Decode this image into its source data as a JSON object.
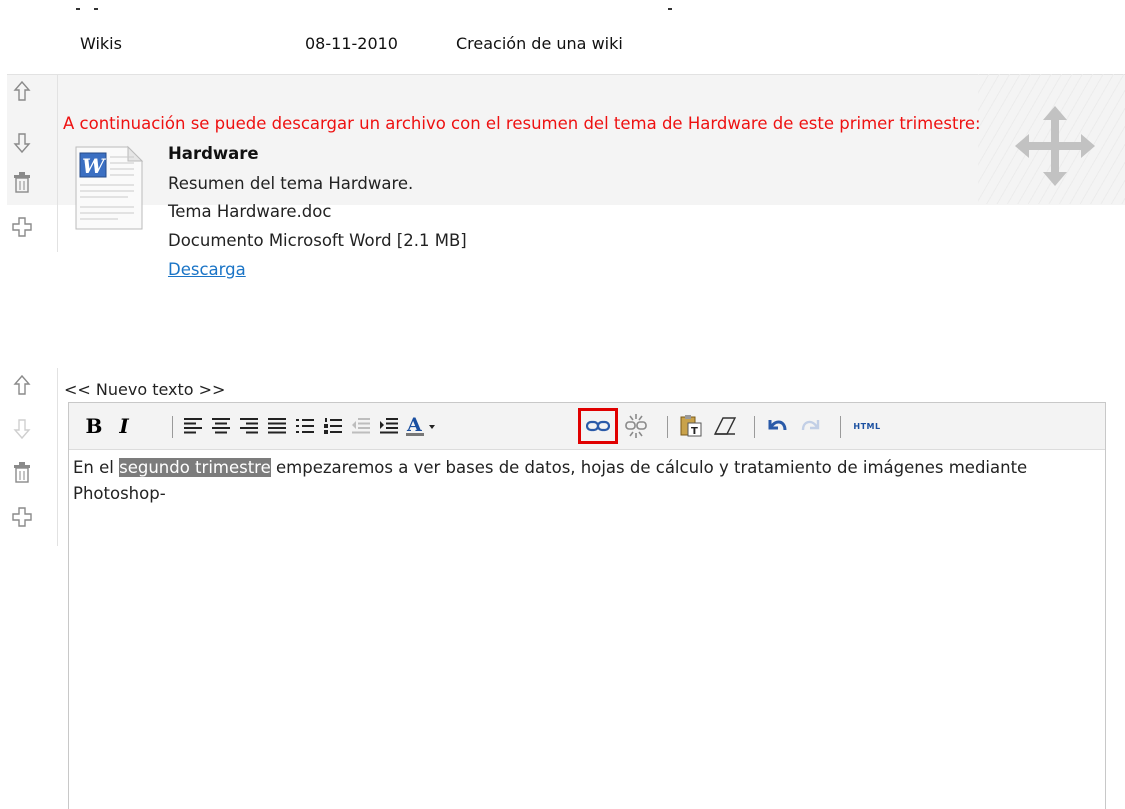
{
  "top_row": {
    "section": "Wikis",
    "date": "08-11-2010",
    "description": "Creación de una wiki"
  },
  "block1": {
    "message": "A continuación se puede descargar un archivo con el resumen del tema de Hardware de este primer trimestre:",
    "file": {
      "title": "Hardware",
      "description": "Resumen del tema Hardware.",
      "filename": "Tema Hardware.doc",
      "type": "Documento Microsoft Word [2.1 MB]",
      "link": "Descarga"
    }
  },
  "block2": {
    "label": "<< Nuevo texto >>",
    "toolbar": {
      "bold": "B",
      "italic": "I",
      "html": "HTML"
    },
    "content_before": "En el ",
    "content_highlight": "segundo trimestre",
    "content_after": " empezaremos a ver bases de datos, hojas de cálculo y tratamiento de imágenes mediante Photoshop-"
  },
  "colors": {
    "message_red": "#ee1111",
    "link_blue": "#1a74c6",
    "highlight_box": "#e00000"
  }
}
